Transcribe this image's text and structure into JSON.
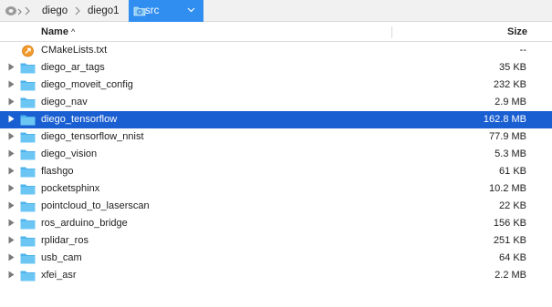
{
  "pathbar": {
    "root_icon": "disk-icon",
    "crumbs": [
      {
        "label": "diego"
      },
      {
        "label": "diego1"
      },
      {
        "label": "src",
        "active": true
      }
    ],
    "active_color": "#2f8ef0"
  },
  "header": {
    "name_label": "Name",
    "size_label": "Size"
  },
  "files": [
    {
      "name": "CMakeLists.txt",
      "size": "--",
      "type": "file"
    },
    {
      "name": "diego_ar_tags",
      "size": "35 KB",
      "type": "folder"
    },
    {
      "name": "diego_moveit_config",
      "size": "232 KB",
      "type": "folder"
    },
    {
      "name": "diego_nav",
      "size": "2.9 MB",
      "type": "folder"
    },
    {
      "name": "diego_tensorflow",
      "size": "162.8 MB",
      "type": "folder",
      "selected": true
    },
    {
      "name": "diego_tensorflow_nnist",
      "size": "77.9 MB",
      "type": "folder"
    },
    {
      "name": "diego_vision",
      "size": "5.3 MB",
      "type": "folder"
    },
    {
      "name": "flashgo",
      "size": "61 KB",
      "type": "folder"
    },
    {
      "name": "pocketsphinx",
      "size": "10.2 MB",
      "type": "folder"
    },
    {
      "name": "pointcloud_to_laserscan",
      "size": "22 KB",
      "type": "folder"
    },
    {
      "name": "ros_arduino_bridge",
      "size": "156 KB",
      "type": "folder"
    },
    {
      "name": "rplidar_ros",
      "size": "251 KB",
      "type": "folder"
    },
    {
      "name": "usb_cam",
      "size": "64 KB",
      "type": "folder"
    },
    {
      "name": "xfei_asr",
      "size": "2.2 MB",
      "type": "folder"
    }
  ],
  "colors": {
    "selection": "#1a5fd1",
    "folder": "#5bbcf0"
  }
}
